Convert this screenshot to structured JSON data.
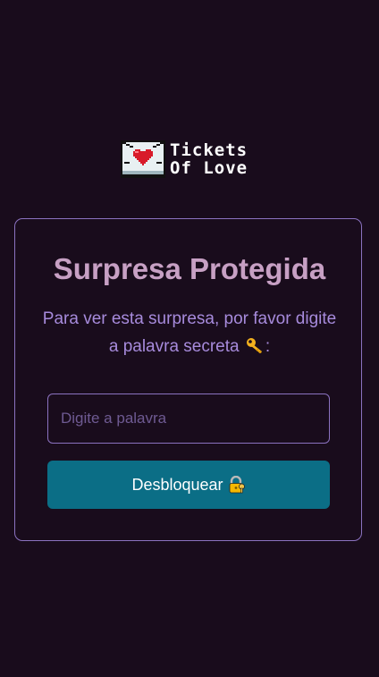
{
  "logo": {
    "line1": "Tickets",
    "line2": "Of Love"
  },
  "card": {
    "title": "Surpresa Protegida",
    "description_part1": "Para ver esta surpresa, por favor digite a palavra secreta",
    "description_part2": ":",
    "description_icon": "key-icon"
  },
  "password_input": {
    "placeholder": "Digite a palavra",
    "value": ""
  },
  "unlock_button": {
    "label": "Desbloquear",
    "icon": "locked-with-key-icon"
  },
  "colors": {
    "background": "#190c1c",
    "card_border": "#8b72c0",
    "title": "#c7a0c4",
    "description": "#a78bdc",
    "button": "#0b6e86",
    "button_text": "#ffffff"
  }
}
